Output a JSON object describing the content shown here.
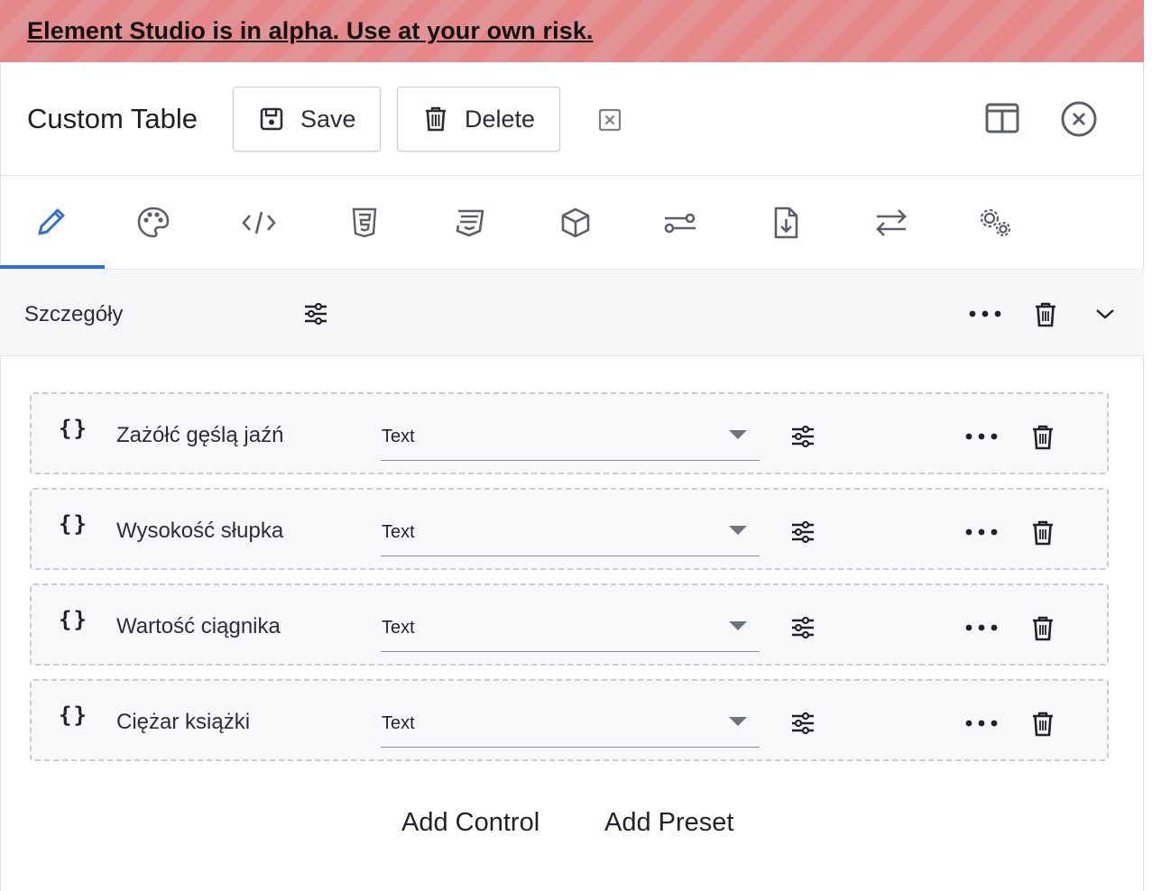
{
  "banner": {
    "text": "Element Studio is in alpha. Use at your own risk."
  },
  "header": {
    "title": "Custom Table",
    "save_label": "Save",
    "delete_label": "Delete"
  },
  "tabs": [
    {
      "icon": "pencil-icon",
      "active": true
    },
    {
      "icon": "palette-icon"
    },
    {
      "icon": "code-icon"
    },
    {
      "icon": "html5-icon"
    },
    {
      "icon": "css3-icon"
    },
    {
      "icon": "cube-icon"
    },
    {
      "icon": "toggle-icon"
    },
    {
      "icon": "file-download-icon"
    },
    {
      "icon": "arrows-exchange-icon"
    },
    {
      "icon": "gears-icon"
    }
  ],
  "section": {
    "title": "Szczegóły"
  },
  "controls": [
    {
      "braces": "{}",
      "name": "Zażółć gęślą jaźń",
      "type": "Text"
    },
    {
      "braces": "{}",
      "name": "Wysokość słupka",
      "type": "Text"
    },
    {
      "braces": "{}",
      "name": "Wartość ciągnika",
      "type": "Text"
    },
    {
      "braces": "{}",
      "name": "Ciężar książki",
      "type": "Text"
    }
  ],
  "footer": {
    "add_control": "Add Control",
    "add_preset": "Add Preset"
  },
  "colors": {
    "accent": "#2f6fd6",
    "banner_stripe_a": "#e6888a",
    "banner_stripe_b": "#e19396"
  }
}
